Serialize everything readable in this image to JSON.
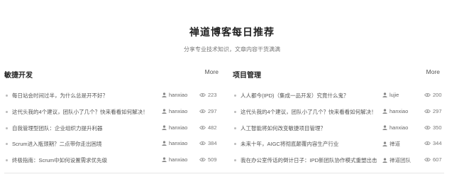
{
  "header": {
    "title": "禅道博客每日推荐",
    "subtitle": "分享专业技术知识，文章内容干货满满"
  },
  "columns": [
    {
      "title": "敏捷开发",
      "more_label": "More",
      "items": [
        {
          "title": "每日站会时间过半，为什么总是开不好？",
          "author": "hanxiao",
          "views": "223"
        },
        {
          "title": "这代头我的4个建议，团队小了几个？快来看看如何解决！",
          "author": "hanxiao",
          "views": "297"
        },
        {
          "title": "自我管理型团队：企业组织力提升利器",
          "author": "hanxiao",
          "views": "482"
        },
        {
          "title": "Scrum进入瓶颈期？二点带你走出困境",
          "author": "hanxiao",
          "views": "384"
        },
        {
          "title": "终极指南：Scrum中如何设置需求优先级",
          "author": "hanxiao",
          "views": "509"
        }
      ]
    },
    {
      "title": "项目管理",
      "more_label": "More",
      "items": [
        {
          "title": "人人都今(IPD)（集成一品开发）究竟什么鬼？",
          "author": "lujie",
          "views": "200"
        },
        {
          "title": "这代头我的4个建议，团队小了几个？快来看看如何解决！",
          "author": "hanxiao",
          "views": "297"
        },
        {
          "title": "人工智能将如何改变敏捷项目管理？",
          "author": "hanxiao",
          "views": "350"
        },
        {
          "title": "未来十年，AIGC将彻底颠覆内容生产行业",
          "author": "禅道",
          "views": "344"
        },
        {
          "title": "我在办公室传话的倒计日子：IPD新团队协作模式重塑出击",
          "author": "禅道团队",
          "views": "607"
        }
      ]
    }
  ],
  "icons": {
    "author": "user-icon",
    "views": "eye-icon"
  },
  "colors": {
    "text": "#555555",
    "title": "#222222",
    "dot": "#bbbbbb"
  }
}
